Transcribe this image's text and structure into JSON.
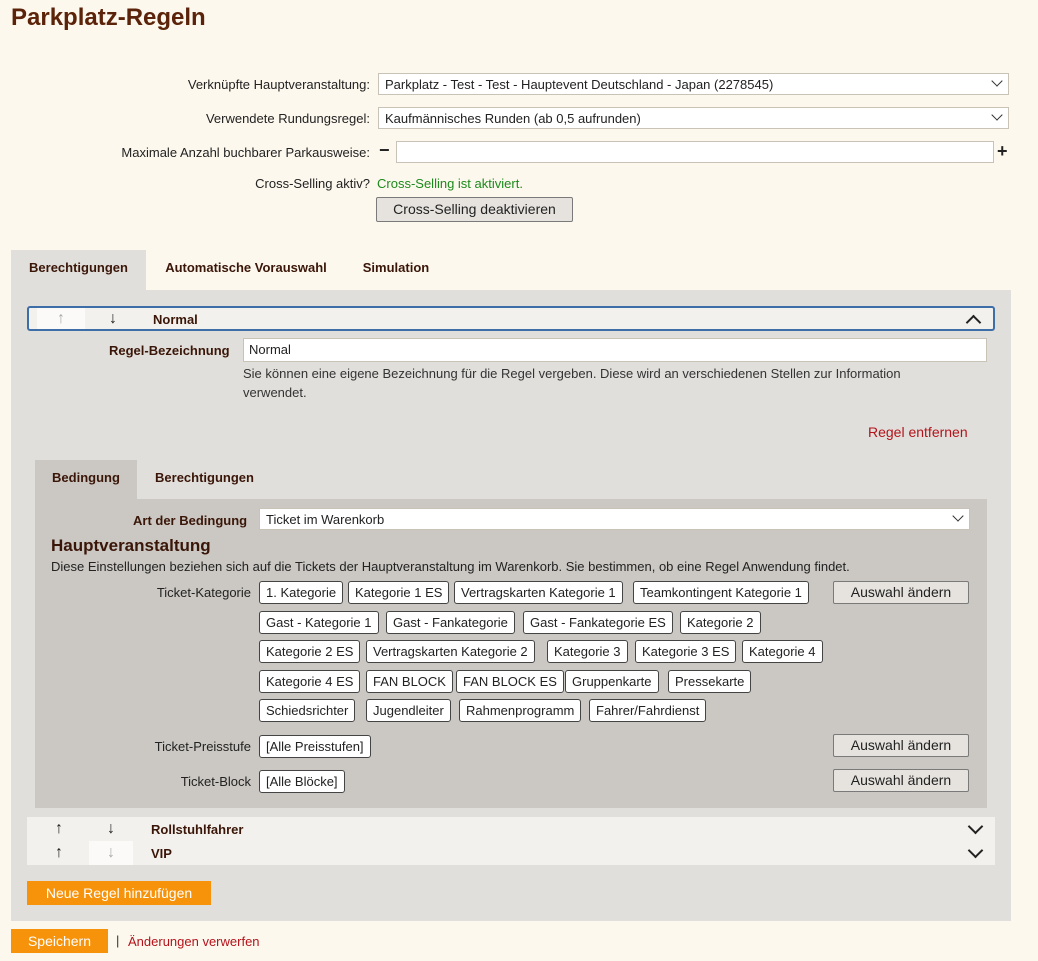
{
  "page": {
    "title": "Parkplatz-Regeln"
  },
  "form": {
    "main_event": {
      "label": "Verknüpfte Hauptveranstaltung:",
      "value": "Parkplatz - Test - Test - Hauptevent Deutschland - Japan (2278545)"
    },
    "rounding": {
      "label": "Verwendete Rundungsregel:",
      "value": "Kaufmännisches Runden (ab 0,5 aufrunden)"
    },
    "max_count": {
      "label": "Maximale Anzahl buchbarer Parkausweise:",
      "value": "",
      "minus": "−",
      "plus": "+"
    },
    "cross_selling": {
      "label": "Cross-Selling aktiv?",
      "status": "Cross-Selling ist aktiviert.",
      "button": "Cross-Selling deaktivieren",
      "status_color": "#1c8a1c"
    }
  },
  "tabs": [
    "Berechtigungen",
    "Automatische Vorauswahl",
    "Simulation"
  ],
  "rules": [
    {
      "name": "Normal",
      "expanded": true
    },
    {
      "name": "Rollstuhlfahrer",
      "expanded": false
    },
    {
      "name": "VIP",
      "expanded": false
    }
  ],
  "rule_detail": {
    "name_label": "Regel-Bezeichnung",
    "name_value": "Normal",
    "hint": "Sie können eine eigene Bezeichnung für die Regel vergeben. Diese wird an verschiedenen Stellen zur Information verwendet.",
    "remove": "Regel entfernen",
    "subtabs": [
      "Bedingung",
      "Berechtigungen"
    ],
    "condition": {
      "type_label": "Art der Bedingung",
      "type_value": "Ticket im Warenkorb",
      "section_title": "Hauptveranstaltung",
      "section_desc": "Diese Einstellungen beziehen sich auf die Tickets der Hauptveranstaltung im Warenkorb. Sie bestimmen, ob eine Regel Anwendung findet.",
      "category_label": "Ticket-Kategorie",
      "categories": [
        "1. Kategorie",
        "Kategorie 1 ES",
        "Vertragskarten Kategorie 1",
        "Teamkontingent Kategorie 1",
        "Gast - Kategorie 1",
        "Gast - Fankategorie",
        "Gast - Fankategorie ES",
        "Kategorie 2",
        "Kategorie 2 ES",
        "Vertragskarten Kategorie 2",
        "Kategorie 3",
        "Kategorie 3 ES",
        "Kategorie 4",
        "Kategorie 4 ES",
        "FAN BLOCK",
        "FAN BLOCK ES",
        "Gruppenkarte",
        "Pressekarte",
        "Schiedsrichter",
        "Jugendleiter",
        "Rahmenprogramm",
        "Fahrer/Fahrdienst"
      ],
      "price_label": "Ticket-Preisstufe",
      "price_value": "[Alle Preisstufen]",
      "block_label": "Ticket-Block",
      "block_value": "[Alle Blöcke]",
      "change_button": "Auswahl ändern"
    }
  },
  "actions": {
    "add_rule": "Neue Regel hinzufügen",
    "save": "Speichern",
    "separator": "|",
    "discard": "Änderungen verwerfen"
  },
  "icons": {
    "up": "arrow-up-icon",
    "down": "arrow-down-icon",
    "collapse": "chevron-up-icon",
    "expand": "chevron-down-icon"
  },
  "colors": {
    "brand": "#5b2309",
    "accent": "#f7930a",
    "danger": "#b3131b",
    "success": "#1c8a1c"
  }
}
